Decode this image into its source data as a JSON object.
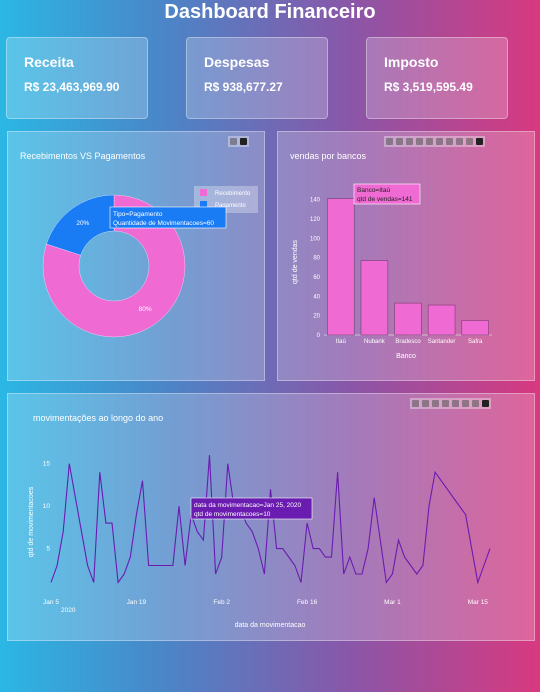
{
  "header": {
    "title": "Dashboard Financeiro"
  },
  "cards": [
    {
      "label": "Receita",
      "value": "R$ 23,463,969.90"
    },
    {
      "label": "Despesas",
      "value": "R$ 938,677.27"
    },
    {
      "label": "Imposto",
      "value": "R$ 3,519,595.49"
    }
  ],
  "colors": {
    "pink": "#f06ad4",
    "blue": "#1a7cf5",
    "line": "#6a1bb0"
  },
  "charts": {
    "pie": {
      "title": "Recebimentos VS Pagamentos",
      "hover": {
        "line1": "Tipo=Pagamento",
        "line2": "Quantidade de Movimentacoes=60"
      }
    },
    "bar": {
      "title": "vendas por bancos",
      "hover": {
        "line1": "Banco=Itaú",
        "line2": "qtd de vendas=141"
      }
    },
    "line": {
      "title": "movimentações ao longo do ano",
      "hover": {
        "line1": "data da movimentacao=Jan 25, 2020",
        "line2": "qtd de movimentacoes=10"
      },
      "year_label": "2020"
    }
  },
  "chart_data": [
    {
      "type": "pie",
      "title": "Recebimentos VS Pagamentos",
      "labels": [
        "Recebimento",
        "Pagamento"
      ],
      "percent_labels": [
        "80%",
        "20%"
      ],
      "values": [
        80,
        20
      ],
      "hole": true,
      "legend": "top-right"
    },
    {
      "type": "bar",
      "title": "vendas por bancos",
      "categories": [
        "Itaú",
        "Nubank",
        "Bradesco",
        "Santander",
        "Safra"
      ],
      "values": [
        141,
        77,
        33,
        31,
        15
      ],
      "xlabel": "Banco",
      "ylabel": "qtd de vendas",
      "ylim": [
        0,
        150
      ],
      "yticks": [
        "0",
        "20",
        "40",
        "60",
        "80",
        "100",
        "120",
        "140"
      ]
    },
    {
      "type": "line",
      "title": "movimentações ao longo do ano",
      "xlabel": "data da movimentacao",
      "ylabel": "qtd de movimentacoes",
      "xticks": [
        "Jan 5",
        "Jan 19",
        "Feb 2",
        "Feb 16",
        "Mar 1",
        "Mar 15"
      ],
      "yticks": [
        "5",
        "10",
        "15"
      ],
      "ylim": [
        0,
        16.5
      ],
      "x": [
        "2020-01-05",
        "2020-01-06",
        "2020-01-07",
        "2020-01-08",
        "2020-01-09",
        "2020-01-10",
        "2020-01-11",
        "2020-01-12",
        "2020-01-13",
        "2020-01-14",
        "2020-01-15",
        "2020-01-16",
        "2020-01-17",
        "2020-01-18",
        "2020-01-19",
        "2020-01-20",
        "2020-01-21",
        "2020-01-22",
        "2020-01-23",
        "2020-01-24",
        "2020-01-25",
        "2020-01-26",
        "2020-01-27",
        "2020-01-28",
        "2020-01-29",
        "2020-01-30",
        "2020-01-31",
        "2020-02-01",
        "2020-02-02",
        "2020-02-03",
        "2020-02-04",
        "2020-02-05",
        "2020-02-06",
        "2020-02-07",
        "2020-02-08",
        "2020-02-09",
        "2020-02-10",
        "2020-02-11",
        "2020-02-12",
        "2020-02-13",
        "2020-02-14",
        "2020-02-15",
        "2020-02-16",
        "2020-02-17",
        "2020-02-18",
        "2020-02-19",
        "2020-02-20",
        "2020-02-21",
        "2020-02-22",
        "2020-02-23",
        "2020-02-24",
        "2020-02-25",
        "2020-02-26",
        "2020-02-27",
        "2020-02-28",
        "2020-02-29",
        "2020-03-01",
        "2020-03-02",
        "2020-03-03",
        "2020-03-04",
        "2020-03-05",
        "2020-03-06",
        "2020-03-07",
        "2020-03-08",
        "2020-03-09",
        "2020-03-10",
        "2020-03-11",
        "2020-03-12",
        "2020-03-13",
        "2020-03-14",
        "2020-03-15",
        "2020-03-16",
        "2020-03-17"
      ],
      "values": [
        1,
        3,
        7,
        15,
        11,
        7,
        3,
        1,
        14,
        8,
        8,
        1,
        2,
        4,
        9,
        13,
        3,
        3,
        3,
        3,
        3,
        10,
        3,
        9,
        7,
        6,
        16,
        2,
        4,
        15,
        10,
        10,
        8,
        7,
        5,
        2,
        12,
        5,
        5,
        4,
        3,
        1,
        8,
        5,
        5,
        4,
        4,
        14,
        2,
        4,
        2,
        2,
        5,
        11,
        6,
        1,
        2,
        6,
        4,
        3,
        2,
        3,
        10,
        14,
        13,
        12,
        11,
        10,
        9,
        5,
        1,
        3,
        5
      ]
    }
  ]
}
